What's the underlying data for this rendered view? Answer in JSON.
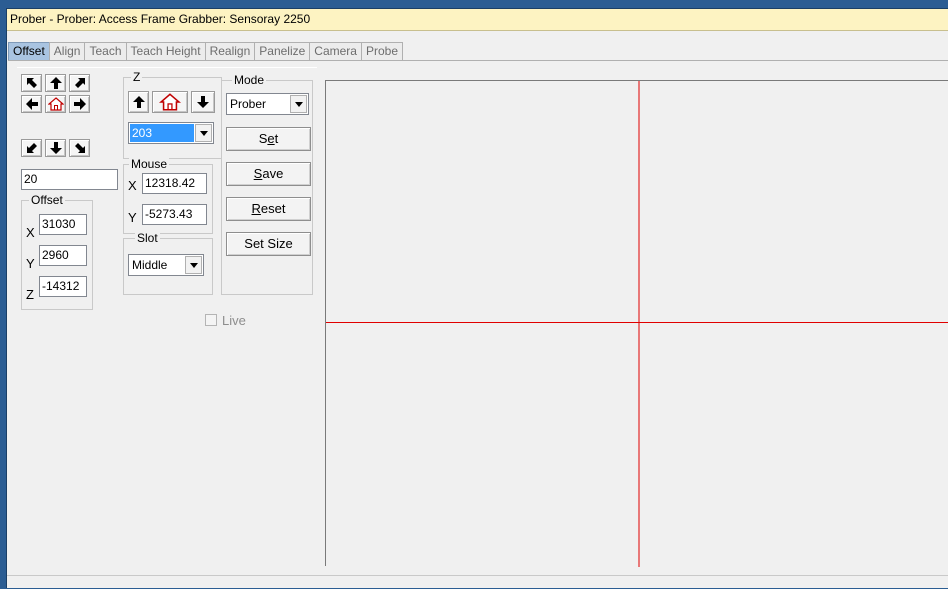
{
  "window": {
    "title": "Prober - Prober: Access Frame Grabber: Sensoray 2250"
  },
  "tabs": [
    {
      "label": "Offset",
      "active": true
    },
    {
      "label": "Align",
      "active": false
    },
    {
      "label": "Teach",
      "active": false
    },
    {
      "label": "Teach Height",
      "active": false
    },
    {
      "label": "Realign",
      "active": false
    },
    {
      "label": "Panelize",
      "active": false
    },
    {
      "label": "Camera",
      "active": false
    },
    {
      "label": "Probe",
      "active": false
    }
  ],
  "jog": {
    "step": "20"
  },
  "z": {
    "legend": "Z",
    "value": "203"
  },
  "mouse": {
    "legend": "Mouse",
    "x_label": "X",
    "x": "12318.42",
    "y_label": "Y",
    "y": "-5273.43"
  },
  "slot": {
    "legend": "Slot",
    "value": "Middle"
  },
  "offset": {
    "legend": "Offset",
    "x_label": "X",
    "x": "31030",
    "y_label": "Y",
    "y": "2960",
    "z_label": "Z",
    "z": "-14312"
  },
  "mode": {
    "legend": "Mode",
    "value": "Prober"
  },
  "buttons": {
    "set": "Set",
    "save": "Save",
    "reset": "Reset",
    "set_size": "Set Size"
  },
  "live": {
    "label": "Live",
    "checked": false
  },
  "colors": {
    "title_bg": "#fdf3c2",
    "active_tab": "#a9c4e1",
    "crosshair": "#e00000",
    "desktop": "#2b5d93"
  }
}
